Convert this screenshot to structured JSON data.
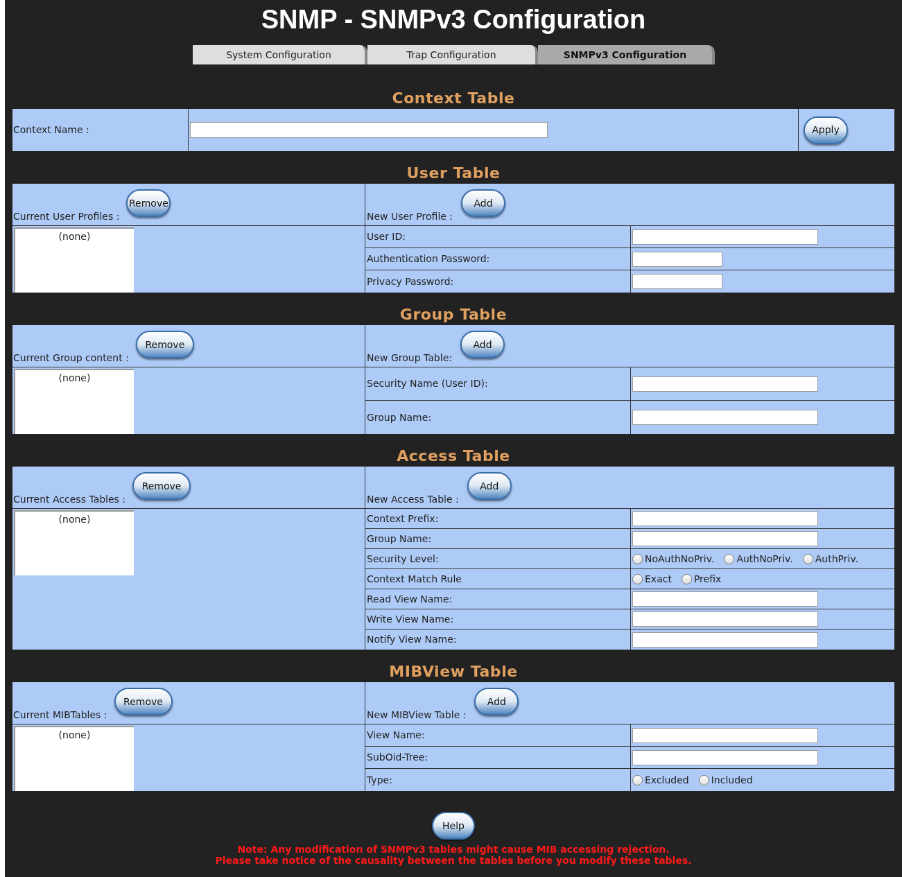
{
  "title": "SNMP - SNMPv3 Configuration",
  "tabs": [
    {
      "label": "System Configuration",
      "selected": false
    },
    {
      "label": "Trap Configuration",
      "selected": false
    },
    {
      "label": "SNMPv3 Configuration",
      "selected": true
    }
  ],
  "context_table": {
    "title": "Context Table",
    "label": "Context Name :",
    "apply_button": "Apply"
  },
  "tables": [
    {
      "title": "User Table",
      "current_label": "Current User Profiles :",
      "remove_button": "Remove",
      "list_items": [
        "(none)"
      ],
      "new_label": "New User Profile :",
      "add_button": "Add",
      "fields": [
        {
          "kind": "text",
          "label": "User ID:"
        },
        {
          "kind": "short",
          "label": "Authentication Password:"
        },
        {
          "kind": "short",
          "label": "Privacy Password:"
        }
      ]
    },
    {
      "title": "Group Table",
      "current_label": "Current Group content :",
      "remove_button": "Remove",
      "list_items": [
        "(none)"
      ],
      "new_label": "New Group Table:",
      "add_button": "Add",
      "fields": [
        {
          "kind": "text",
          "label": "Security Name (User ID):"
        },
        {
          "kind": "text",
          "label": "Group Name:"
        }
      ]
    },
    {
      "title": "Access Table",
      "current_label": "Current Access Tables :",
      "remove_button": "Remove",
      "list_items": [
        "(none)"
      ],
      "new_label": "New Access Table :",
      "add_button": "Add",
      "fields": [
        {
          "kind": "text",
          "label": "Context Prefix:"
        },
        {
          "kind": "text",
          "label": "Group Name:"
        },
        {
          "kind": "radio",
          "label": "Security Level:",
          "options": [
            {
              "label": "NoAuthNoPriv.",
              "selected": false
            },
            {
              "label": "AuthNoPriv.",
              "selected": false
            },
            {
              "label": "AuthPriv.",
              "selected": false
            }
          ]
        },
        {
          "kind": "radio",
          "label": "Context Match Rule",
          "options": [
            {
              "label": "Exact",
              "selected": false
            },
            {
              "label": "Prefix",
              "selected": false
            }
          ]
        },
        {
          "kind": "text",
          "label": "Read View Name:"
        },
        {
          "kind": "text",
          "label": "Write View Name:"
        },
        {
          "kind": "text",
          "label": "Notify View Name:"
        }
      ]
    },
    {
      "title": "MIBView Table",
      "current_label": "Current MIBTables :",
      "remove_button": "Remove",
      "list_items": [
        "(none)"
      ],
      "new_label": "New MIBView Table :",
      "add_button": "Add",
      "fields": [
        {
          "kind": "text",
          "label": "View Name:"
        },
        {
          "kind": "text",
          "label": "SubOid-Tree:"
        },
        {
          "kind": "radio",
          "label": "Type:",
          "options": [
            {
              "label": "Excluded",
              "selected": false
            },
            {
              "label": "Included",
              "selected": false
            }
          ]
        }
      ]
    }
  ],
  "help_button": "Help",
  "notes": [
    "Note: Any modification of SNMPv3 tables might cause MIB accessing rejection.",
    "Please take notice of the causality between the tables before you modify these tables."
  ]
}
